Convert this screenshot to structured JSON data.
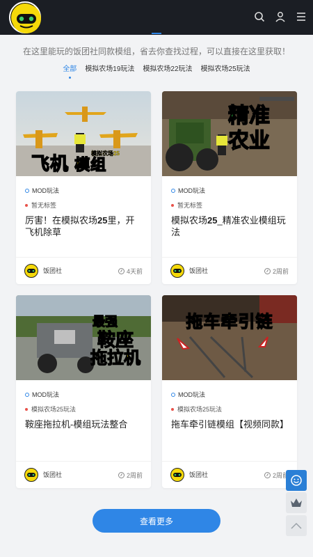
{
  "header": {
    "logo_icon": "gamepad-logo-icon",
    "search_icon": "search-icon",
    "user_icon": "user-icon",
    "menu_icon": "menu-icon"
  },
  "section": {
    "description": "在这里能玩的饭团社同款模组，省去你查找过程，可以直接在这里获取！",
    "tabs": [
      {
        "label": "全部",
        "active": true
      },
      {
        "label": "模拟农场19玩法"
      },
      {
        "label": "模拟农场22玩法"
      },
      {
        "label": "模拟农场25玩法"
      }
    ]
  },
  "cards": [
    {
      "image_overlay": [
        "飞机",
        "模组"
      ],
      "image_small_text": "模拟农场25",
      "category": "MOD玩法",
      "tag": "暂无标签",
      "title_prefix": "厉害！在模拟农场",
      "title_bold": "25",
      "title_suffix": "里，开飞机除草",
      "author": "饭团社",
      "time": "4天前"
    },
    {
      "image_overlay": [
        "精准",
        "农业"
      ],
      "category": "MOD玩法",
      "tag": "暂无标签",
      "title_prefix": "模拟农场",
      "title_bold": "25",
      "title_suffix": "_精准农业模组玩法",
      "author": "饭团社",
      "time": "2周前"
    },
    {
      "image_overlay": [
        "最强",
        "鞍座",
        "拖拉机"
      ],
      "category": "MOD玩法",
      "tag": "模拟农场25玩法",
      "title_prefix": "鞍座拖拉机-模组玩法整合",
      "title_bold": "",
      "title_suffix": "",
      "author": "饭团社",
      "time": "2周前"
    },
    {
      "image_overlay": [
        "拖车牵引链"
      ],
      "category": "MOD玩法",
      "tag": "模拟农场25玩法",
      "title_prefix": "拖车牵引链模组【视频同款】",
      "title_bold": "",
      "title_suffix": "",
      "author": "饭团社",
      "time": "2周前"
    }
  ],
  "load_more": "查看更多",
  "floating": {
    "customer_service_icon": "smile-chat-icon",
    "vip_icon": "crown-icon",
    "back_top_icon": "chevron-up-icon"
  },
  "colors": {
    "accent": "#2f86e6",
    "header_bg": "#1b1e24",
    "overlay_yellow": "#f5d90a",
    "tag_dot": "#e8524a"
  }
}
